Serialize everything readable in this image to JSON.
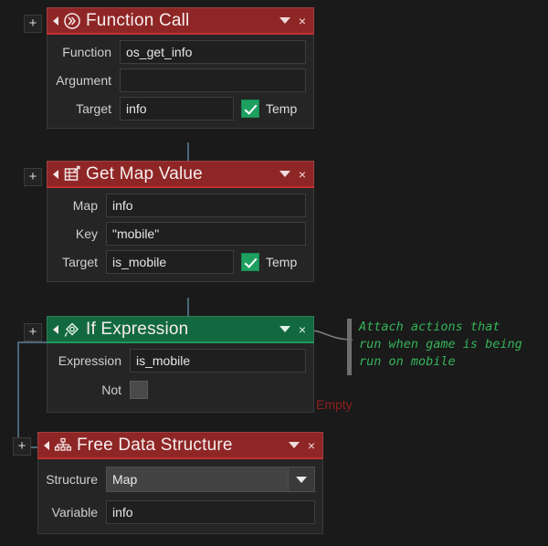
{
  "theme": {
    "background": "#1a1a1a",
    "block_red": "#8f2626",
    "block_green": "#13693f",
    "connector": "#4a6878",
    "comment_green": "#35b45a",
    "empty_red": "#8e2020"
  },
  "blocks": [
    {
      "id": "function-call",
      "title": "Function Call",
      "color": "red",
      "icon": "function-call-icon",
      "collapse_label": "◀",
      "menu_label": "▼",
      "close_label": "×",
      "add_label": "+",
      "rows": [
        {
          "label": "Function",
          "value": "os_get_info",
          "type": "text"
        },
        {
          "label": "Argument",
          "value": "",
          "type": "text"
        },
        {
          "label": "Target",
          "value": "info",
          "type": "text-check",
          "check_label": "Temp",
          "checked": true
        }
      ]
    },
    {
      "id": "get-map-value",
      "title": "Get Map Value",
      "color": "red",
      "icon": "get-map-value-icon",
      "collapse_label": "◀",
      "menu_label": "▼",
      "close_label": "×",
      "add_label": "+",
      "rows": [
        {
          "label": "Map",
          "value": "info",
          "type": "text"
        },
        {
          "label": "Key",
          "value": "\"mobile\"",
          "type": "text"
        },
        {
          "label": "Target",
          "value": "is_mobile",
          "type": "text-check",
          "check_label": "Temp",
          "checked": true
        }
      ]
    },
    {
      "id": "if-expression",
      "title": "If Expression",
      "color": "green",
      "icon": "if-expression-icon",
      "collapse_label": "◀",
      "menu_label": "▼",
      "close_label": "×",
      "add_label": "+",
      "rows": [
        {
          "label": "Expression",
          "value": "is_mobile",
          "type": "text"
        },
        {
          "label": "Not",
          "value": "",
          "type": "checkbox",
          "checked": false
        }
      ]
    },
    {
      "id": "free-data-structure",
      "title": "Free Data Structure",
      "color": "red",
      "icon": "free-data-structure-icon",
      "collapse_label": "◀",
      "menu_label": "▼",
      "close_label": "×",
      "add_label": "+",
      "rows": [
        {
          "label": "Structure",
          "value": "Map",
          "type": "dropdown"
        },
        {
          "label": "Variable",
          "value": "info",
          "type": "text"
        }
      ]
    }
  ],
  "comment": {
    "line1": "Attach actions that",
    "line2": "run when game is being",
    "line3": "run on mobile"
  },
  "empty_branch_label": "Empty"
}
